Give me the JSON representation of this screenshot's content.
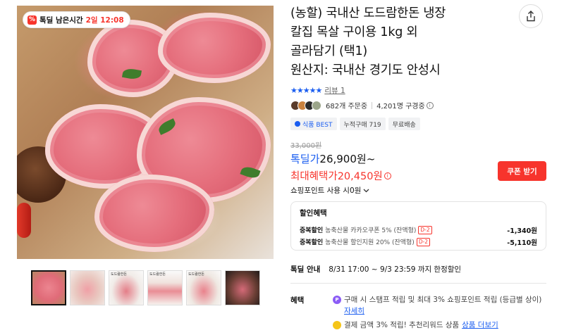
{
  "deal_badge": {
    "icon": "percent-icon",
    "label": "톡딜 남은시간",
    "timer": "2일 12:08"
  },
  "product": {
    "title_line1": "(농할) 국내산 도드람한돈 냉장",
    "title_line2": "칼집 목살 구이용 1kg 외",
    "title_line3": "골라담기 (택1)",
    "title_line4": "원산지: 국내산 경기도 안성시"
  },
  "rating": {
    "stars": "★★★★★",
    "review_text": "리뷰 1"
  },
  "stats": {
    "orders": "682개 주문중",
    "subscribers": "4,201명 구경중",
    "info": "i"
  },
  "tags": [
    "식품 BEST",
    "누적구매 719",
    "무료배송"
  ],
  "price": {
    "original": "33,000원",
    "deal_label": "톡딜가",
    "deal_value": "26,900원~",
    "max_benefit": "최대혜택가20,450원",
    "coupon_button": "쿠폰 받기",
    "points": "쇼핑포인트 사용 시0원"
  },
  "discount": {
    "head": "할인혜택",
    "rows": [
      {
        "name": "중복할인",
        "desc": "농축산물 카카오쿠폰 5% (잔액형)",
        "badge": "D-2",
        "amount": "-1,340원"
      },
      {
        "name": "중복할인",
        "desc": "농축산물 할인지원 20% (잔액형)",
        "badge": "D-2",
        "amount": "-5,110원"
      }
    ]
  },
  "deal_info": {
    "key": "톡딜 안내",
    "value": "8/31 17:00 ~ 9/3 23:59 까지 한정할인"
  },
  "benefits": {
    "label": "혜택",
    "b1_icon": "P",
    "b1_text": "구매 시 스탬프 적립 및 최대 3% 쇼핑포인트 적립 (등급별 상이)",
    "b1_link": "자세히",
    "b2_text": "결제 금액 3% 적립! 추천리워드 상품",
    "b2_link": "상품 더보기"
  },
  "thumbnails": [
    "",
    "",
    "도드람한돈",
    "도드람한돈",
    "도드람한돈",
    ""
  ],
  "colors": {
    "accent_red": "#f7342c",
    "accent_blue": "#1a5df0"
  }
}
